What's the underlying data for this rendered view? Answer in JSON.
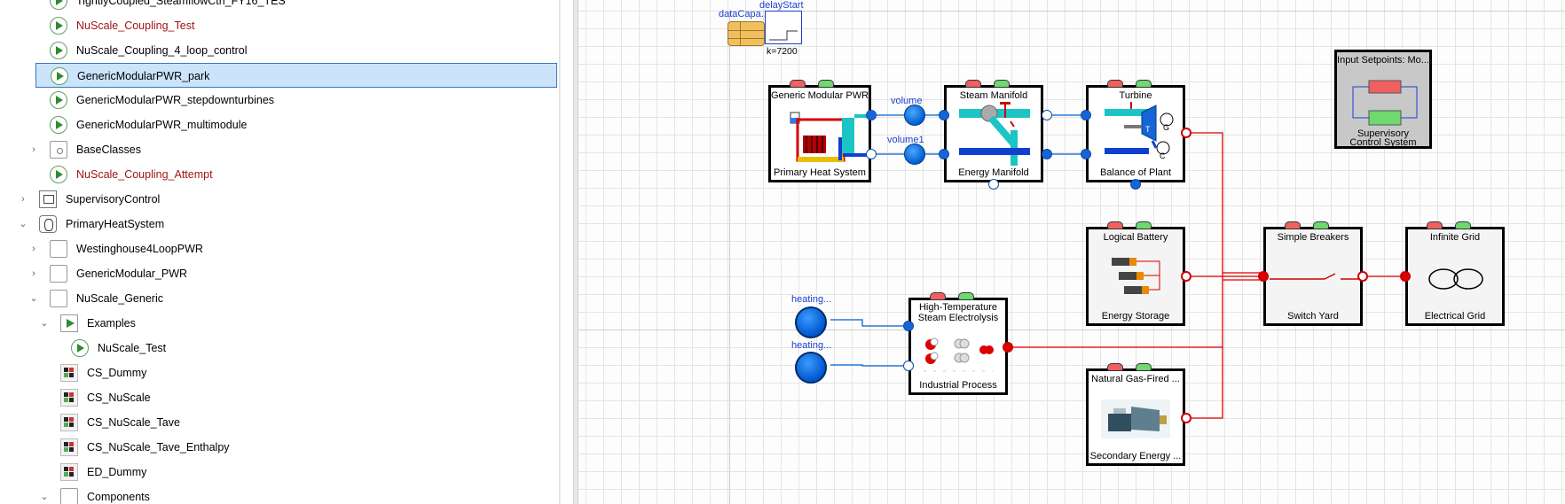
{
  "tree": {
    "items": [
      {
        "label": "TightlyCoupled_SteamflowCtrl_FY16_TES",
        "icon": "run-icon",
        "indent": 1,
        "chevron": "",
        "red": false
      },
      {
        "label": "NuScale_Coupling_Test",
        "icon": "run-icon",
        "indent": 1,
        "chevron": "",
        "red": true
      },
      {
        "label": "NuScale_Coupling_4_loop_control",
        "icon": "run-icon",
        "indent": 1,
        "chevron": "",
        "red": false
      },
      {
        "label": "GenericModularPWR_park",
        "icon": "run-icon",
        "indent": 1,
        "chevron": "",
        "red": false,
        "selected": true
      },
      {
        "label": "GenericModularPWR_stepdownturbines",
        "icon": "run-icon",
        "indent": 1,
        "chevron": "",
        "red": false
      },
      {
        "label": "GenericModularPWR_multimodule",
        "icon": "run-icon",
        "indent": 1,
        "chevron": "",
        "red": false
      },
      {
        "label": "BaseClasses",
        "icon": "package-icon",
        "indent": 1,
        "chevron": ">",
        "red": false
      },
      {
        "label": "NuScale_Coupling_Attempt",
        "icon": "run-icon",
        "indent": 1,
        "chevron": "",
        "red": true
      },
      {
        "label": "SupervisoryControl",
        "icon": "supervisory-icon",
        "indent": 0,
        "chevron": ">",
        "red": false
      },
      {
        "label": "PrimaryHeatSystem",
        "icon": "phs-icon",
        "indent": 0,
        "chevron": "v",
        "red": false
      },
      {
        "label": "Westinghouse4LoopPWR",
        "icon": "box-icon",
        "indent": 1,
        "chevron": ">",
        "red": false
      },
      {
        "label": "GenericModular_PWR",
        "icon": "box-icon",
        "indent": 1,
        "chevron": ">",
        "red": false
      },
      {
        "label": "NuScale_Generic",
        "icon": "box-icon",
        "indent": 1,
        "chevron": "v",
        "red": false
      },
      {
        "label": "Examples",
        "icon": "play-package-icon",
        "indent": 2,
        "chevron": "v",
        "red": false
      },
      {
        "label": "NuScale_Test",
        "icon": "run-icon",
        "indent": 3,
        "chevron": "",
        "red": false
      },
      {
        "label": "CS_Dummy",
        "icon": "control-system-icon",
        "indent": 2,
        "chevron": "",
        "red": false
      },
      {
        "label": "CS_NuScale",
        "icon": "control-system-icon",
        "indent": 2,
        "chevron": "",
        "red": false
      },
      {
        "label": "CS_NuScale_Tave",
        "icon": "control-system-icon",
        "indent": 2,
        "chevron": "",
        "red": false
      },
      {
        "label": "CS_NuScale_Tave_Enthalpy",
        "icon": "control-system-icon",
        "indent": 2,
        "chevron": "",
        "red": false
      },
      {
        "label": "ED_Dummy",
        "icon": "event-driver-icon",
        "indent": 2,
        "chevron": "",
        "red": false
      },
      {
        "label": "Components",
        "icon": "box-icon",
        "indent": 2,
        "chevron": "v",
        "red": false
      }
    ]
  },
  "diagram": {
    "data_capacity_label": "dataCapa...",
    "delay_start_label": "delayStart",
    "delay_k_label": "k=7200",
    "volume_label": "volume",
    "volume1_label": "volume1",
    "heating1_label": "heating...",
    "heating2_label": "heating...",
    "blocks": {
      "phs": {
        "title": "Generic Modular PWR",
        "subtitle": "Primary Heat System"
      },
      "steam_manifold": {
        "title": "Steam Manifold",
        "subtitle": "Energy Manifold"
      },
      "turbine": {
        "title": "Turbine",
        "subtitle": "Balance of Plant"
      },
      "supervisory": {
        "title": "Input Setpoints: Mo...",
        "subtitle1": "Supervisory",
        "subtitle2": "Control System"
      },
      "battery": {
        "title": "Logical Battery",
        "subtitle": "Energy Storage"
      },
      "breakers": {
        "title": "Simple Breakers",
        "subtitle": "Switch Yard"
      },
      "grid": {
        "title": "Infinite Grid",
        "subtitle": "Electrical Grid"
      },
      "electrolysis": {
        "title1": "High-Temperature",
        "title2": "Steam Electrolysis",
        "subtitle": "Industrial Process"
      },
      "gas": {
        "title": "Natural Gas-Fired ...",
        "subtitle": "Secondary Energy ..."
      }
    },
    "turbine_g_label": "G",
    "turbine_c_label": "C",
    "turbine_t_label": "T"
  },
  "colors": {
    "selection_bg": "#cce4fb",
    "selection_border": "#3876c5",
    "fluid_port": "#1565d8",
    "electrical_wire": "#e00000",
    "fluid_wire": "#2b78d8",
    "bus_red": "#f06060",
    "bus_green": "#6fd86f"
  }
}
